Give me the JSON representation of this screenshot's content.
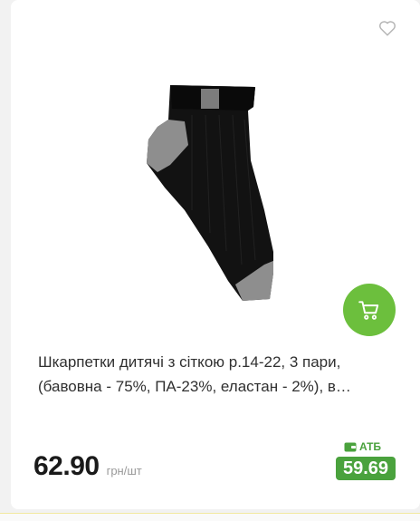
{
  "product": {
    "title": "Шкарпетки дитячі з сіткою р.14-22, 3 пари, (бавовна - 75%, ПА-23%, еластан - 2%), в асортименті",
    "price": "62.90",
    "unit": "грн/шт",
    "atb_label": "АТБ",
    "atb_price": "59.69",
    "image_alt": "Шкарпетки дитячі з сіткою"
  },
  "icons": {
    "favorite": "heart-icon",
    "cart": "cart-icon",
    "wallet": "wallet-icon"
  },
  "colors": {
    "accent_green": "#6cbf3d",
    "price_badge": "#4aa23d",
    "sock_black": "#111111",
    "sock_grey": "#8c8c8c"
  }
}
